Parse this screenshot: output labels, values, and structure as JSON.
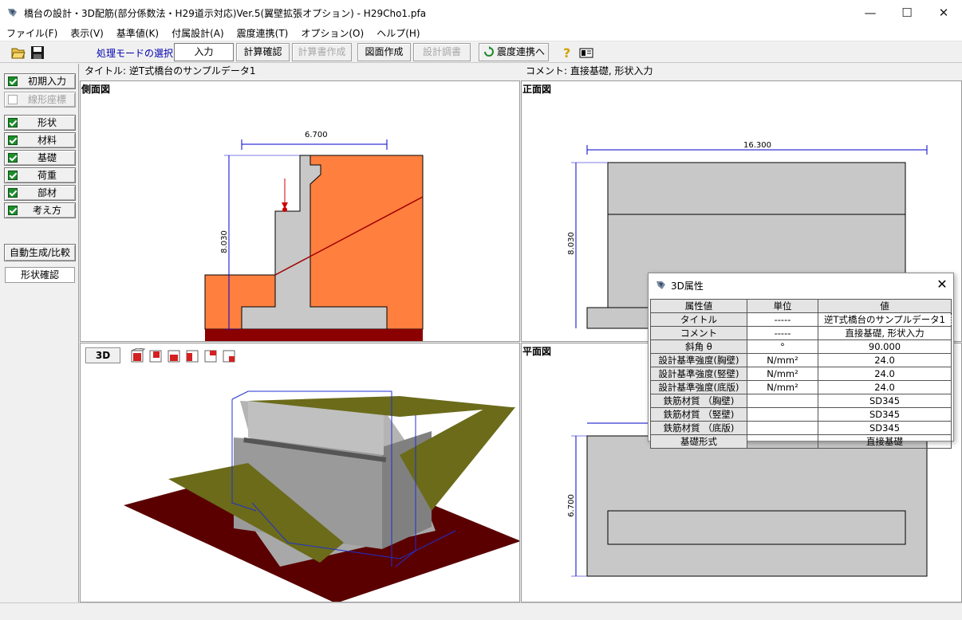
{
  "window": {
    "title": "橋台の設計・3D配筋(部分係数法・H29道示対応)Ver.5(翼壁拡張オプション) - H29Cho1.pfa",
    "minimize": "—",
    "maximize": "☐",
    "close": "✕"
  },
  "menu": [
    "ファイル(F)",
    "表示(V)",
    "基準値(K)",
    "付属設計(A)",
    "震度連携(T)",
    "オプション(O)",
    "ヘルプ(H)"
  ],
  "toolbar": {
    "mode_label": "処理モードの選択",
    "input": "入力",
    "calc_check": "計算確認",
    "report_make": "計算書作成",
    "drawing": "図面作成",
    "design_doc": "設計調書",
    "seismic_link": "震度連携へ"
  },
  "sidebar": {
    "initial_input": "初期入力",
    "linear_coord": "線形座標",
    "shape": "形状",
    "material": "材料",
    "foundation": "基礎",
    "load": "荷重",
    "member": "部材",
    "approach": "考え方",
    "auto_generate": "自動生成/比較",
    "shape_check": "形状確認"
  },
  "info": {
    "title_label": "タイトル:",
    "title_value": "逆T式橋台のサンプルデータ1",
    "comment_label": "コメント:",
    "comment_value": "直接基礎, 形状入力"
  },
  "views": {
    "side": {
      "label": "側面図",
      "dim_width": "6.700",
      "dim_height": "8.030"
    },
    "front": {
      "label": "正面図",
      "dim_width": "16.300",
      "dim_height": "8.030"
    },
    "view3d": {
      "button": "3D"
    },
    "plan": {
      "label": "平面図",
      "dim_height": "6.700"
    }
  },
  "dialog": {
    "title": "3D属性",
    "headers": [
      "属性値",
      "単位",
      "値"
    ],
    "rows": [
      {
        "name": "タイトル",
        "unit": "-----",
        "value": "逆T式橋台のサンプルデータ1"
      },
      {
        "name": "コメント",
        "unit": "-----",
        "value": "直接基礎, 形状入力"
      },
      {
        "name": "斜角 θ",
        "unit": "°",
        "value": "90.000"
      },
      {
        "name": "設計基準強度(胸壁)",
        "unit": "N/mm²",
        "value": "24.0"
      },
      {
        "name": "設計基準強度(竪壁)",
        "unit": "N/mm²",
        "value": "24.0"
      },
      {
        "name": "設計基準強度(底版)",
        "unit": "N/mm²",
        "value": "24.0"
      },
      {
        "name": "鉄筋材質 （胸壁)",
        "unit": "",
        "value": "SD345"
      },
      {
        "name": "鉄筋材質 （竪壁)",
        "unit": "",
        "value": "SD345"
      },
      {
        "name": "鉄筋材質 （底版)",
        "unit": "",
        "value": "SD345"
      },
      {
        "name": "基礎形式",
        "unit": "",
        "value": "直接基礎"
      }
    ]
  },
  "colors": {
    "soil": "#ff7f3f",
    "concrete": "#c8c8c8",
    "ground": "#8b0000",
    "dim": "#0000cc",
    "wing": "#6b6b1a"
  }
}
